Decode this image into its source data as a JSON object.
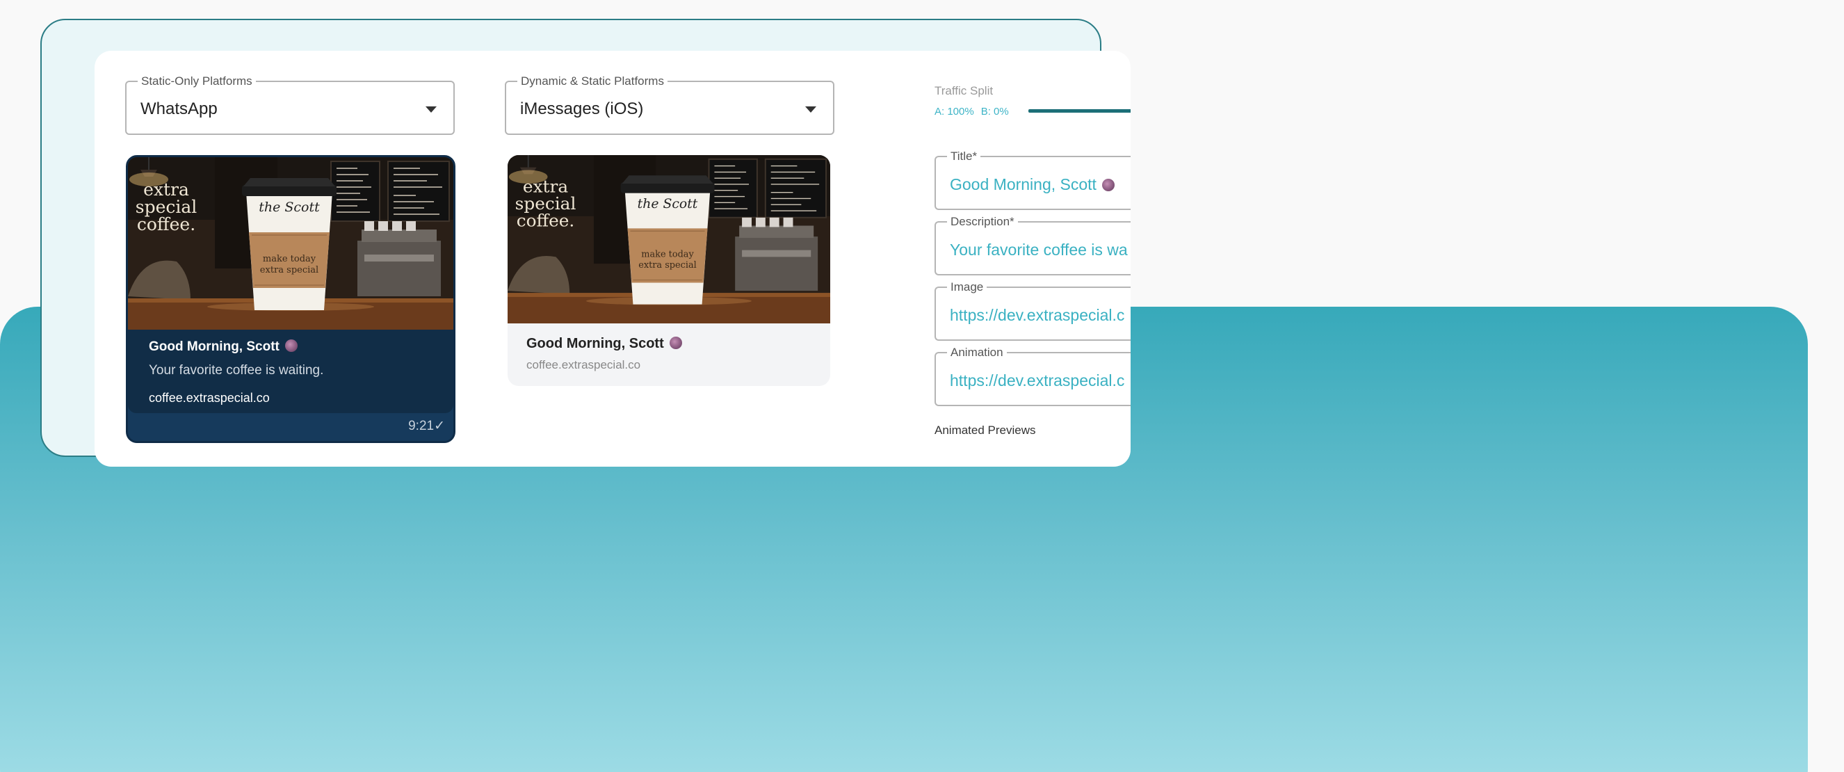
{
  "colors": {
    "accent": "#3eb4c7",
    "dark_teal": "#1c6f78",
    "whatsapp_bg": "#163a5c"
  },
  "static_platforms": {
    "label": "Static-Only Platforms",
    "value": "WhatsApp"
  },
  "dynamic_platforms": {
    "label": "Dynamic & Static Platforms",
    "value": "iMessages (iOS)"
  },
  "whatsapp_preview": {
    "title": "Good Morning, Scott",
    "description": "Your favorite coffee is waiting.",
    "link": "coffee.extraspecial.co",
    "time": "9:21",
    "check": "✓"
  },
  "imessage_preview": {
    "title": "Good Morning, Scott",
    "link": "coffee.extraspecial.co"
  },
  "coffee_image": {
    "cup_handwriting": "the Scott",
    "sign_lines": [
      "extra",
      "special",
      "coffee."
    ],
    "sleeve_lines": [
      "make today",
      "extra special"
    ]
  },
  "traffic_split": {
    "label": "Traffic Split",
    "a_label": "A: 100%",
    "b_label": "B: 0%",
    "a_fraction": 1.0
  },
  "fields": {
    "title": {
      "label": "Title*",
      "value": "Good Morning, Scott"
    },
    "description": {
      "label": "Description*",
      "value": "Your favorite coffee is wa"
    },
    "image": {
      "label": "Image",
      "value": "https://dev.extraspecial.c"
    },
    "animation": {
      "label": "Animation",
      "value": "https://dev.extraspecial.c"
    }
  },
  "animated_previews_label": "Animated Previews"
}
